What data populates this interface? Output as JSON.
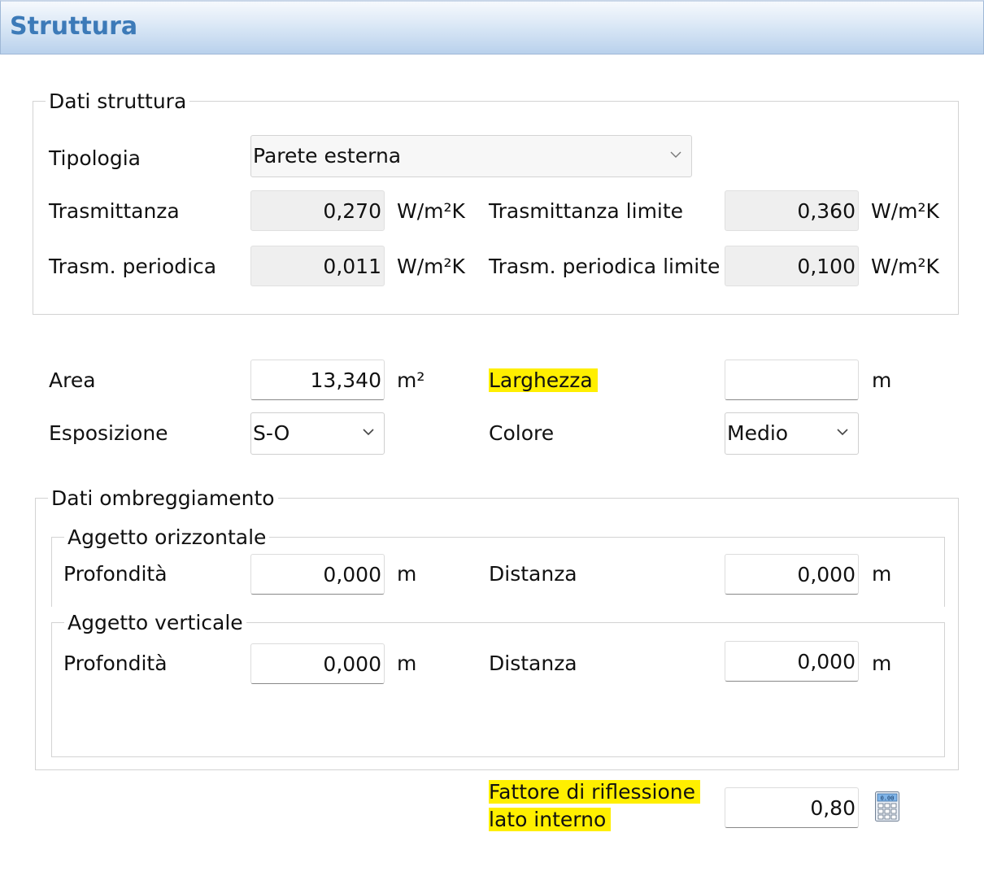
{
  "window": {
    "title": "Struttura"
  },
  "dati_struttura": {
    "legend": "Dati struttura",
    "tipologia": {
      "label": "Tipologia",
      "value": "Parete esterna"
    },
    "trasmittanza": {
      "label": "Trasmittanza",
      "value": "0,270",
      "unit": "W/m²K"
    },
    "trasmittanza_limite": {
      "label": "Trasmittanza limite",
      "value": "0,360",
      "unit": "W/m²K"
    },
    "trasm_periodica": {
      "label": "Trasm. periodica",
      "value": "0,011",
      "unit": "W/m²K"
    },
    "trasm_periodica_limite": {
      "label": "Trasm. periodica limite",
      "value": "0,100",
      "unit": "W/m²K"
    }
  },
  "area": {
    "label": "Area",
    "value": "13,340",
    "unit": "m²"
  },
  "larghezza": {
    "label": "Larghezza",
    "value": "",
    "unit": "m"
  },
  "esposizione": {
    "label": "Esposizione",
    "value": "S-O"
  },
  "colore": {
    "label": "Colore",
    "value": "Medio"
  },
  "ombreggiamento": {
    "legend": "Dati ombreggiamento",
    "orizzontale": {
      "legend": "Aggetto orizzontale",
      "profondita": {
        "label": "Profondità",
        "value": "0,000",
        "unit": "m"
      },
      "distanza": {
        "label": "Distanza",
        "value": "0,000",
        "unit": "m"
      }
    },
    "verticale": {
      "legend": "Aggetto verticale",
      "profondita": {
        "label": "Profondità",
        "value": "0,000",
        "unit": "m"
      },
      "distanza": {
        "label": "Distanza",
        "value": "0,000",
        "unit": "m"
      }
    }
  },
  "riflessione": {
    "label_line1": "Fattore di riflessione",
    "label_line2": "lato interno",
    "value": "0,80",
    "calc_display": "0.00"
  },
  "colors": {
    "highlight": "#ffef00",
    "title": "#3c7ab8"
  },
  "icons": {
    "dropdown": "chevron-down-icon",
    "calculator": "calculator-icon"
  }
}
